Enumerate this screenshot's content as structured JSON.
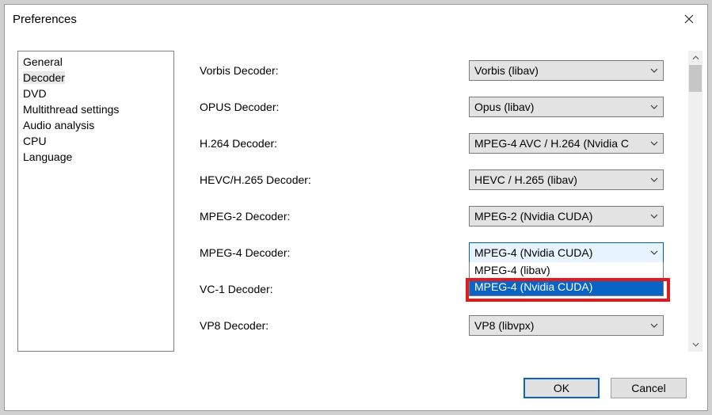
{
  "window": {
    "title": "Preferences"
  },
  "sidebar": {
    "items": [
      {
        "label": "General"
      },
      {
        "label": "Decoder",
        "selected": true
      },
      {
        "label": "DVD"
      },
      {
        "label": "Multithread settings"
      },
      {
        "label": "Audio analysis"
      },
      {
        "label": "CPU"
      },
      {
        "label": "Language"
      }
    ]
  },
  "settings": [
    {
      "label": "Vorbis Decoder:",
      "value": "Vorbis (libav)"
    },
    {
      "label": "OPUS Decoder:",
      "value": "Opus (libav)"
    },
    {
      "label": "H.264 Decoder:",
      "value": "MPEG-4 AVC / H.264 (Nvidia C"
    },
    {
      "label": "HEVC/H.265 Decoder:",
      "value": "HEVC / H.265 (libav)"
    },
    {
      "label": "MPEG-2 Decoder:",
      "value": "MPEG-2 (Nvidia CUDA)"
    },
    {
      "label": "MPEG-4 Decoder:",
      "value": "MPEG-4 (Nvidia CUDA)",
      "open": true,
      "options": [
        {
          "label": "MPEG-4 (libav)"
        },
        {
          "label": "MPEG-4 (Nvidia CUDA)",
          "highlighted": true
        }
      ]
    },
    {
      "label": "VC-1 Decoder:",
      "value": ""
    },
    {
      "label": "VP8 Decoder:",
      "value": "VP8 (libvpx)"
    }
  ],
  "buttons": {
    "ok": "OK",
    "cancel": "Cancel"
  }
}
